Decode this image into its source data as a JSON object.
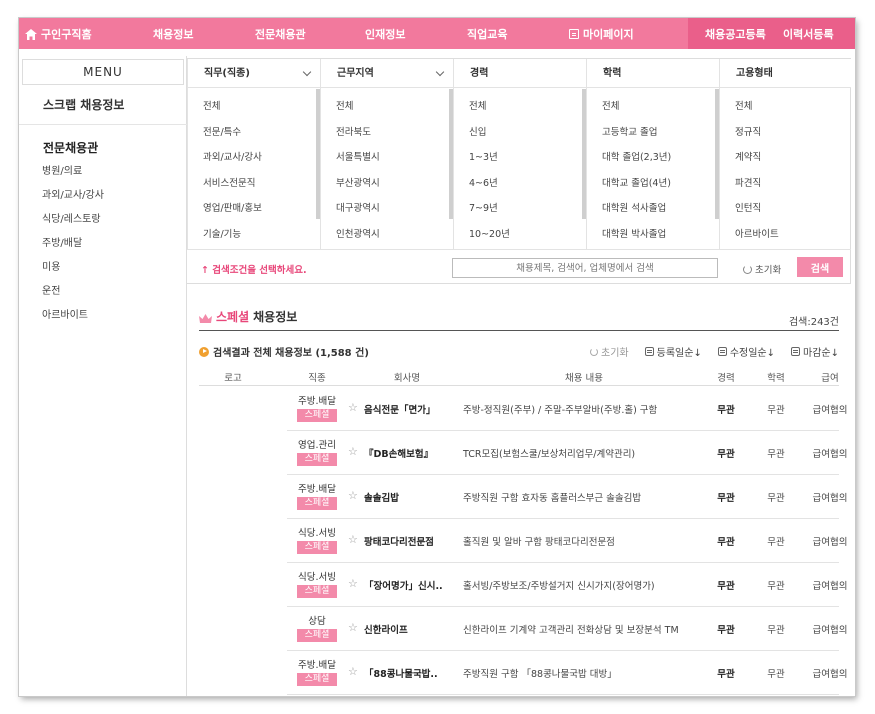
{
  "nav": {
    "home": "구인구직홈",
    "items": [
      "채용정보",
      "전문채용관",
      "인재정보",
      "직업교육"
    ],
    "mypage": "마이페이지",
    "right": [
      "채용공고등록",
      "이력서등록"
    ]
  },
  "sidebar": {
    "menu_title": "MENU",
    "scrap": "스크랩 채용정보",
    "section_title": "전문채용관",
    "items": [
      "병원/의료",
      "과외/교사/강사",
      "식당/레스토랑",
      "주방/배달",
      "미용",
      "운전",
      "아르바이트"
    ]
  },
  "filters": {
    "columns": [
      {
        "title": "직무(직종)",
        "items": [
          "전체",
          "전문/특수",
          "과외/교사/강사",
          "서비스전문직",
          "영업/판매/홍보",
          "기술/기능"
        ]
      },
      {
        "title": "근무지역",
        "items": [
          "전체",
          "전라북도",
          "서울특별시",
          "부산광역시",
          "대구광역시",
          "인천광역시"
        ]
      },
      {
        "title": "경력",
        "items": [
          "전체",
          "신입",
          "1~3년",
          "4~6년",
          "7~9년",
          "10~20년"
        ]
      },
      {
        "title": "학력",
        "items": [
          "전체",
          "고등학교 졸업",
          "대학 졸업(2,3년)",
          "대학교 졸업(4년)",
          "대학원 석사졸업",
          "대학원 박사졸업"
        ]
      },
      {
        "title": "고용형태",
        "items": [
          "전체",
          "정규직",
          "계약직",
          "파견직",
          "인턴직",
          "아르바이트"
        ]
      }
    ],
    "hint": "↑ 검색조건을 선택하세요.",
    "search_placeholder": "채용제목, 검색어, 업체명에서 검색",
    "reset_label": "초기화",
    "search_button": "검색"
  },
  "special": {
    "title_pink": "스페셜",
    "title_rest": "채용정보",
    "count": "검색:243건"
  },
  "results": {
    "label": "검색결과 전체 채용정보 (1,588 건)",
    "sort_reset": "초기화",
    "sorts": [
      "등록일순↓",
      "수정일순↓",
      "마감순↓"
    ],
    "columns": [
      "로고",
      "직종",
      "회사명",
      "채용 내용",
      "경력",
      "학력",
      "급여"
    ],
    "rows": [
      {
        "type": "주방.배달",
        "badge": "스페셜",
        "company": "음식전문「면가」",
        "content": "주방-정직원(주부) / 주말-주부알바(주방.홀) 구함",
        "career": "무관",
        "edu": "무관",
        "salary": "급여협의"
      },
      {
        "type": "영업.관리",
        "badge": "스페셜",
        "company": "『DB손해보험』",
        "content": "TCR모집(보험스쿨/보상처리업무/계약관리)",
        "career": "무관",
        "edu": "무관",
        "salary": "급여협의"
      },
      {
        "type": "주방.배달",
        "badge": "스페셜",
        "company": "솔솔김밥",
        "content": "주방직원 구함 효자동 홈플러스부근 솔솔김밥",
        "career": "무관",
        "edu": "무관",
        "salary": "급여협의"
      },
      {
        "type": "식당.서빙",
        "badge": "스페셜",
        "company": "팡태코다리전문점",
        "content": "홀직원 및 알바 구함 팡태코다리전문점",
        "career": "무관",
        "edu": "무관",
        "salary": "급여협의"
      },
      {
        "type": "식당.서빙",
        "badge": "스페셜",
        "company": "「장어명가」신시..",
        "content": "홀서빙/주방보조/주방설거지 신시가지(장어명가)",
        "career": "무관",
        "edu": "무관",
        "salary": "급여협의"
      },
      {
        "type": "상담",
        "badge": "스페셜",
        "company": "신한라이프",
        "content": "신한라이프 기계약 고객관리 전화상담 및 보장분석 TM",
        "career": "무관",
        "edu": "무관",
        "salary": "급여협의"
      },
      {
        "type": "주방.배달",
        "badge": "스페셜",
        "company": "「88콩나물국밥..",
        "content": "주방직원 구함 「88콩나물국밥 대방」",
        "career": "무관",
        "edu": "무관",
        "salary": "급여협의"
      }
    ]
  }
}
